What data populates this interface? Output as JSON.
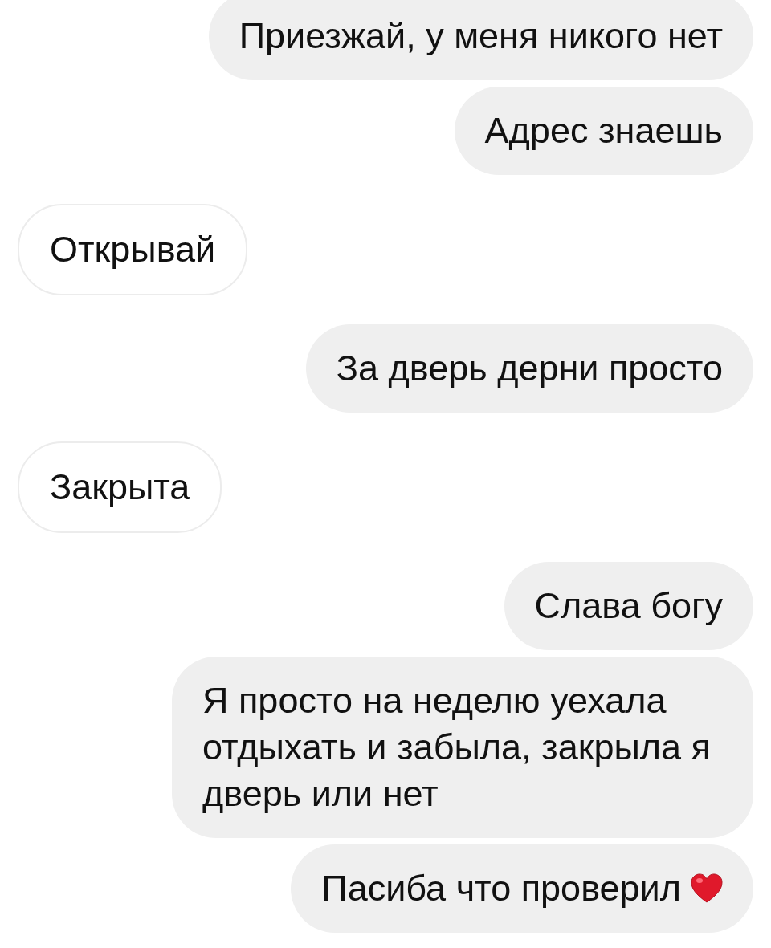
{
  "messages": [
    {
      "kind": "outgoing",
      "text": "Приезжай, у меня никого нет",
      "heart": false
    },
    {
      "kind": "outgoing",
      "text": "Адрес знаешь",
      "heart": false
    },
    {
      "kind": "incoming",
      "text": "Открывай",
      "heart": false
    },
    {
      "kind": "outgoing",
      "text": "За дверь дерни просто",
      "heart": false
    },
    {
      "kind": "incoming",
      "text": "Закрыта",
      "heart": false
    },
    {
      "kind": "outgoing",
      "text": "Слава богу",
      "heart": false
    },
    {
      "kind": "outgoing",
      "text": "Я просто на неделю уехала отдыхать и забыла, закрыла я дверь или нет",
      "heart": false
    },
    {
      "kind": "outgoing",
      "text": "Пасиба что проверил",
      "heart": true
    }
  ]
}
